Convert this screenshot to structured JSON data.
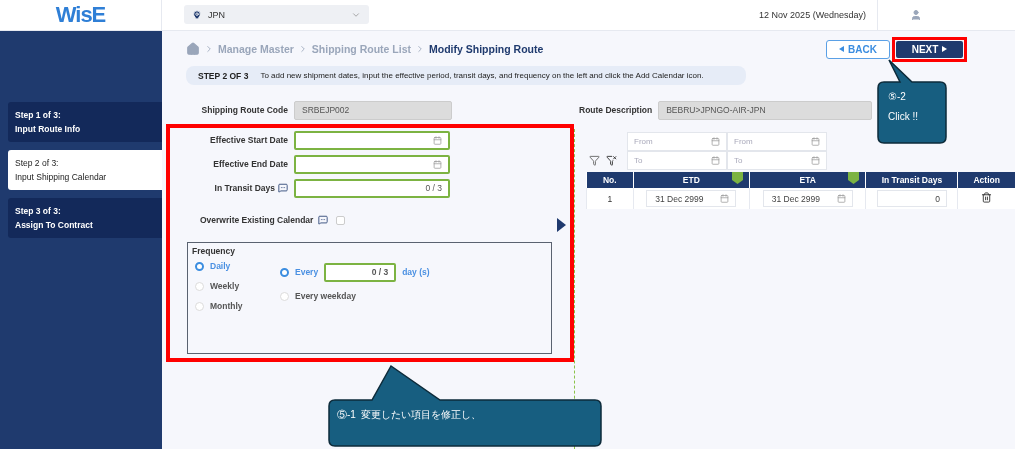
{
  "header": {
    "logo": "WisE",
    "country": "JPN",
    "date": "12 Nov 2025 (Wednesday)"
  },
  "sidebar": {
    "steps": [
      {
        "step": "Step 1 of 3:",
        "label": "Input Route Info",
        "selected": false
      },
      {
        "step": "Step 2 of 3:",
        "label": "Input Shipping Calendar",
        "selected": true
      },
      {
        "step": "Step 3 of 3:",
        "label": "Assign To Contract",
        "selected": false
      }
    ]
  },
  "breadcrumb": [
    "Manage Master",
    "Shipping Route List",
    "Modify Shipping Route"
  ],
  "back_button": {
    "label": "BACK"
  },
  "next_button": {
    "label": "NEXT",
    "highlighted": true
  },
  "step_banner": {
    "step": "STEP 2 OF 3",
    "text": "To add new shipment dates, input the effective period, transit days, and frequency on the left and click the Add Calendar icon."
  },
  "route_code": {
    "label": "Shipping Route Code",
    "value": "SRBEJP002"
  },
  "route_description": {
    "label": "Route Description",
    "value": "BEBRU>JPNGO-AIR-JPN"
  },
  "form": {
    "highlighted": true,
    "fields": [
      {
        "kind": "date",
        "label": "Effective Start Date",
        "info": false
      },
      {
        "kind": "date",
        "label": "Effective End Date",
        "info": false
      },
      {
        "kind": "counter",
        "label": "In Transit Days",
        "info": true,
        "counter": "0 / 3"
      }
    ],
    "overwrite": {
      "label": "Overwrite Existing Calendar",
      "checked": false
    },
    "frequency": {
      "title": "Frequency",
      "options": [
        {
          "label": "Daily",
          "selected": true
        },
        {
          "label": "Weekly",
          "selected": false
        },
        {
          "label": "Monthly",
          "selected": false
        }
      ],
      "repeat": [
        {
          "kind": "interval",
          "label": "Every",
          "selected": true,
          "counter": "0 / 3",
          "unit": "day (s)"
        },
        {
          "kind": "plain",
          "label": "Every weekday",
          "selected": false
        }
      ]
    }
  },
  "table": {
    "filters": [
      {
        "from": "From",
        "to": "To"
      },
      {
        "from": "From",
        "to": "To"
      }
    ],
    "columns": [
      "No.",
      "ETD",
      "ETA",
      "In Transit Days",
      "Action"
    ],
    "rows": [
      {
        "no": "1",
        "etd": "31 Dec 2999",
        "eta": "31 Dec 2999",
        "transit_days": "0"
      }
    ]
  },
  "callouts": [
    {
      "lines": [
        "⑤-2",
        "Click !!"
      ]
    },
    {
      "lines": [
        "⑤-1  変更したい項目を修正し、"
      ]
    }
  ]
}
